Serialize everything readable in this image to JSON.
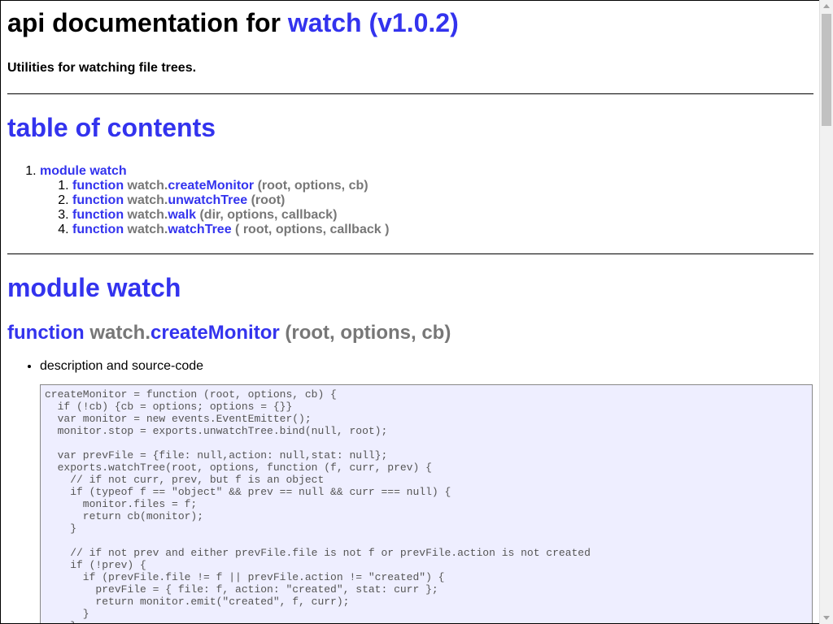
{
  "page": {
    "title_prefix": "api documentation for ",
    "title_link": "watch (v1.0.2)",
    "subtitle": "Utilities for watching file trees."
  },
  "toc": {
    "heading": "table of contents",
    "module_label": "module watch",
    "items": [
      {
        "kw": "function",
        "obj": "watch.",
        "name": "createMonitor",
        "sig": " (root, options, cb)"
      },
      {
        "kw": "function",
        "obj": "watch.",
        "name": "unwatchTree",
        "sig": " (root)"
      },
      {
        "kw": "function",
        "obj": "watch.",
        "name": "walk",
        "sig": " (dir, options, callback)"
      },
      {
        "kw": "function",
        "obj": "watch.",
        "name": "watchTree",
        "sig": " ( root, options, callback )"
      }
    ]
  },
  "module": {
    "heading": "module watch",
    "fn_kw": "function",
    "fn_obj": "watch.",
    "fn_name": "createMonitor",
    "fn_sig": " (root, options, cb)",
    "desc_label": "description and source-code",
    "code": "createMonitor = function (root, options, cb) {\n  if (!cb) {cb = options; options = {}}\n  var monitor = new events.EventEmitter();\n  monitor.stop = exports.unwatchTree.bind(null, root);\n\n  var prevFile = {file: null,action: null,stat: null};\n  exports.watchTree(root, options, function (f, curr, prev) {\n    // if not curr, prev, but f is an object\n    if (typeof f == \"object\" && prev == null && curr === null) {\n      monitor.files = f;\n      return cb(monitor);\n    }\n\n    // if not prev and either prevFile.file is not f or prevFile.action is not created\n    if (!prev) {\n      if (prevFile.file != f || prevFile.action != \"created\") {\n        prevFile = { file: f, action: \"created\", stat: curr };\n        return monitor.emit(\"created\", f, curr);\n      }\n    }"
  },
  "colors": {
    "link": "#3333ee",
    "muted": "#777777",
    "code_bg": "#eeeeff"
  }
}
